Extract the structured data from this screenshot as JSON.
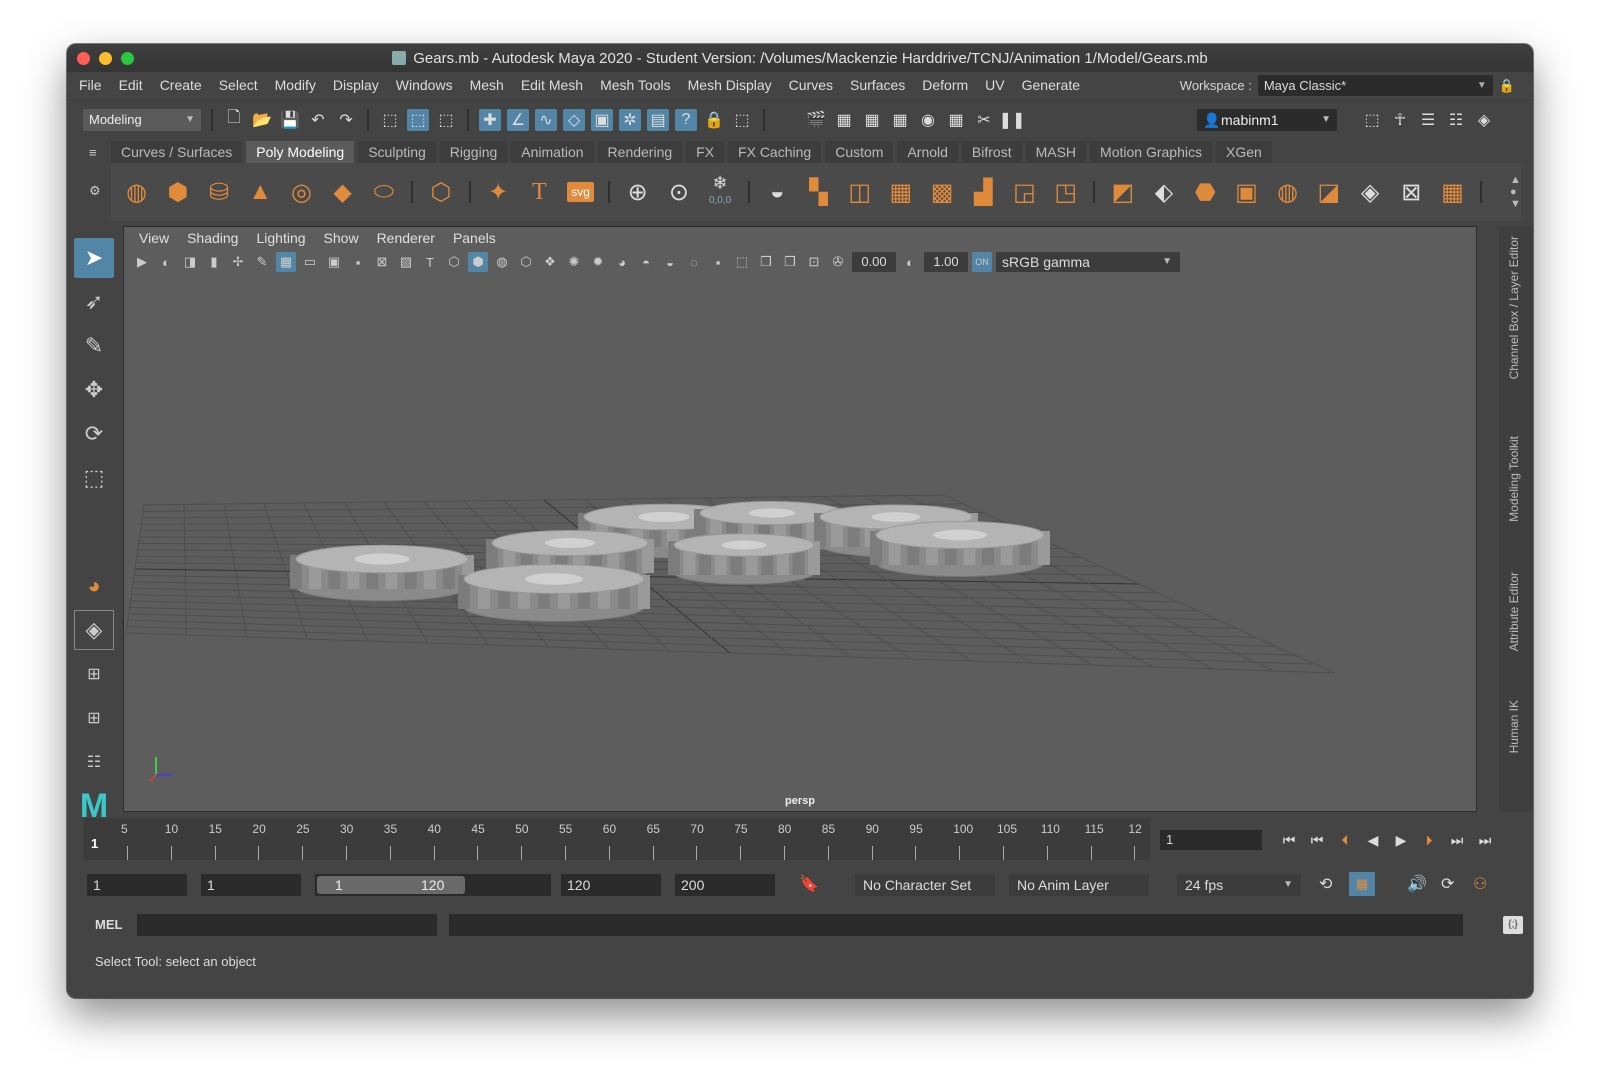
{
  "window": {
    "title": "Gears.mb - Autodesk Maya 2020 - Student Version: /Volumes/Mackenzie Harddrive/TCNJ/Animation 1/Model/Gears.mb"
  },
  "menubar": [
    "File",
    "Edit",
    "Create",
    "Select",
    "Modify",
    "Display",
    "Windows",
    "Mesh",
    "Edit Mesh",
    "Mesh Tools",
    "Mesh Display",
    "Curves",
    "Surfaces",
    "Deform",
    "UV",
    "Generate"
  ],
  "workspace": {
    "label": "Workspace :",
    "value": "Maya Classic*"
  },
  "statusline": {
    "mode": "Modeling",
    "user": "mabinm1"
  },
  "shelf_tabs": [
    "Curves / Surfaces",
    "Poly Modeling",
    "Sculpting",
    "Rigging",
    "Animation",
    "Rendering",
    "FX",
    "FX Caching",
    "Custom",
    "Arnold",
    "Bifrost",
    "MASH",
    "Motion Graphics",
    "XGen"
  ],
  "shelf_active": "Poly Modeling",
  "shelf_icons": [
    "sphere-icon",
    "cube-icon",
    "cylinder-icon",
    "cone-icon",
    "torus-icon",
    "plane-icon",
    "disc-icon",
    "platonic-icon",
    "star-icon",
    "type-tool-icon",
    "svg-icon",
    "pivot-icon",
    "center-pivot-icon",
    "freeze-icon",
    "combine-icon",
    "separate-icon",
    "extract-icon",
    "smooth-icon",
    "bevel-icon",
    "bridge-icon",
    "extrude-icon",
    "fill-hole-icon",
    "multi-cut-icon",
    "target-weld-icon",
    "mirror-icon",
    "boolean-icon"
  ],
  "svg_label": "svg",
  "freeze_label": "0,0,0",
  "viewport": {
    "menu": [
      "View",
      "Shading",
      "Lighting",
      "Show",
      "Renderer",
      "Panels"
    ],
    "exposure": "0.00",
    "gamma": "1.00",
    "color_space": "sRGB gamma",
    "camera": "persp"
  },
  "right_tabs": [
    "Channel Box / Layer Editor",
    "Modeling Toolkit",
    "Attribute Editor",
    "Human IK"
  ],
  "timeline": {
    "ticks": [
      "5",
      "10",
      "15",
      "20",
      "25",
      "30",
      "35",
      "40",
      "45",
      "50",
      "55",
      "60",
      "65",
      "70",
      "75",
      "80",
      "85",
      "90",
      "95",
      "100",
      "105",
      "110",
      "115",
      "12"
    ],
    "start_marker": "1",
    "current_frame": "1"
  },
  "range": {
    "start": "1",
    "playback_start": "1",
    "slider_left": "1",
    "slider_right": "120",
    "playback_end": "120",
    "end": "200",
    "character_set": "No Character Set",
    "anim_layer": "No Anim Layer",
    "fps": "24 fps"
  },
  "mel": {
    "label": "MEL"
  },
  "help": "Select Tool: select an object"
}
